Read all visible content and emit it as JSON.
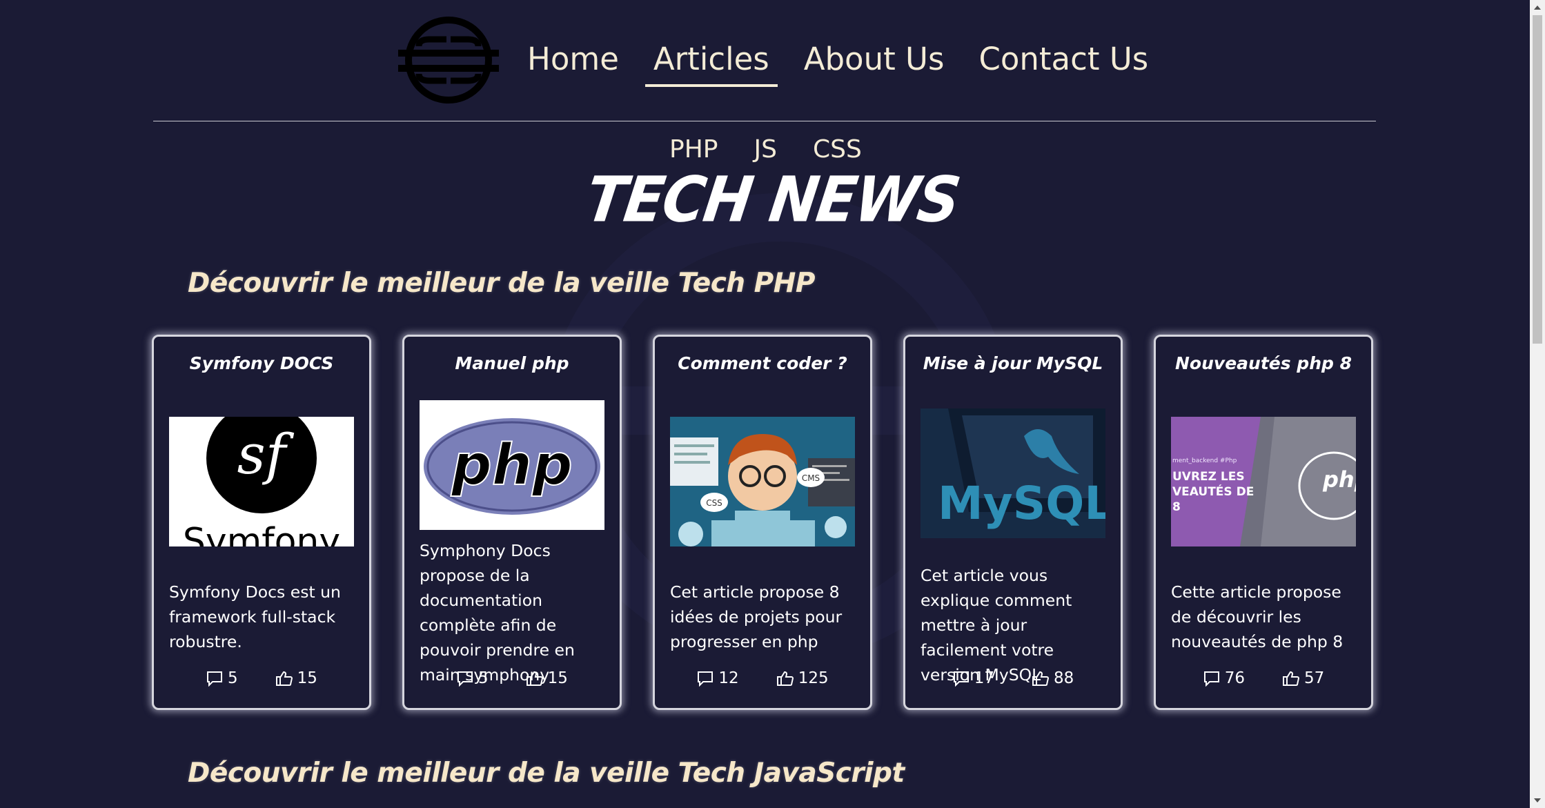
{
  "nav": {
    "items": [
      {
        "label": "Home",
        "active": false
      },
      {
        "label": "Articles",
        "active": true
      },
      {
        "label": "About Us",
        "active": false
      },
      {
        "label": "Contact Us",
        "active": false
      }
    ]
  },
  "subnav": {
    "items": [
      "PHP",
      "JS",
      "CSS"
    ]
  },
  "site_title": "TECH NEWS",
  "sections": [
    {
      "heading": "Découvrir le meilleur de la veille Tech PHP"
    },
    {
      "heading": "Découvrir le meilleur de la veille Tech JavaScript"
    }
  ],
  "cards": [
    {
      "title": "Symfony DOCS",
      "image_label": "Symfony",
      "text": "Symfony Docs est un framework full-stack robustre.",
      "comments": "5",
      "likes": "15"
    },
    {
      "title": "Manuel php",
      "image_label": "php",
      "text": "Symphony Docs propose de la documentation complète afin de pouvoir prendre en main symphony",
      "comments": "5",
      "likes": "15"
    },
    {
      "title": "Comment coder ?",
      "image_label": "CMS",
      "image_label_2": "CSS",
      "text": "Cet article propose 8 idées de projets pour progresser en php",
      "comments": "12",
      "likes": "125"
    },
    {
      "title": "Mise à jour MySQL",
      "image_label": "MySQL",
      "text": "Cet article vous explique comment mettre à jour facilement votre version MySQL",
      "comments": "17",
      "likes": "88"
    },
    {
      "title": "Nouveautés php 8",
      "image_label": "php",
      "image_caption": "ment_backend #Php",
      "image_caption_2": "UVREZ LES",
      "image_caption_3": "VEAUTÉS DE",
      "image_caption_4": "8",
      "text": "Cette article propose de découvrir les nouveautés de php 8",
      "comments": "76",
      "likes": "57"
    }
  ],
  "colors": {
    "background": "#1b1b35",
    "text": "#f4ecd6",
    "card_border": "#d6d6de"
  }
}
